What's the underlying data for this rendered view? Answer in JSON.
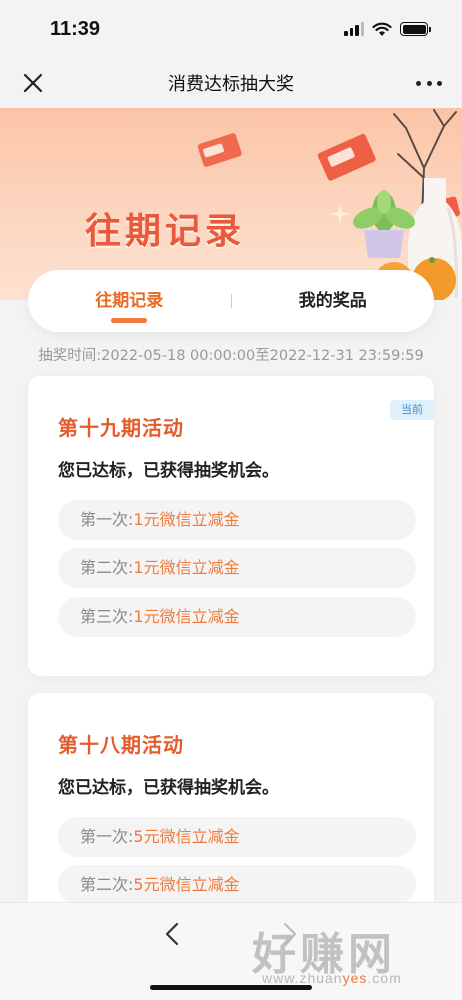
{
  "status_bar": {
    "time": "11:39"
  },
  "nav": {
    "title": "消费达标抽大奖"
  },
  "banner": {
    "title": "往期记录"
  },
  "tabs": [
    {
      "label": "往期记录",
      "active": true
    },
    {
      "label": "我的奖品",
      "active": false
    }
  ],
  "time_range": "抽奖时间:2022-05-18 00:00:00至2022-12-31 23:59:59",
  "cards": [
    {
      "title": "第十九期活动",
      "badge": "当前",
      "desc": "您已达标，已获得抽奖机会。",
      "prizes": [
        {
          "label": "第一次:",
          "value": "1元微信立减金"
        },
        {
          "label": "第二次:",
          "value": "1元微信立减金"
        },
        {
          "label": "第三次:",
          "value": "1元微信立减金"
        }
      ]
    },
    {
      "title": "第十八期活动",
      "desc": "您已达标，已获得抽奖机会。",
      "prizes": [
        {
          "label": "第一次:",
          "value": "5元微信立减金"
        },
        {
          "label": "第二次:",
          "value": "5元微信立减金"
        }
      ]
    }
  ],
  "watermark": {
    "main": "好赚网",
    "url_prefix": "www.zhuan",
    "url_highlight": "yes",
    "url_suffix": ".com"
  },
  "colors": {
    "accent": "#ea6a23",
    "banner": "#fbc4a6",
    "badge_bg": "#e0f0fb"
  }
}
